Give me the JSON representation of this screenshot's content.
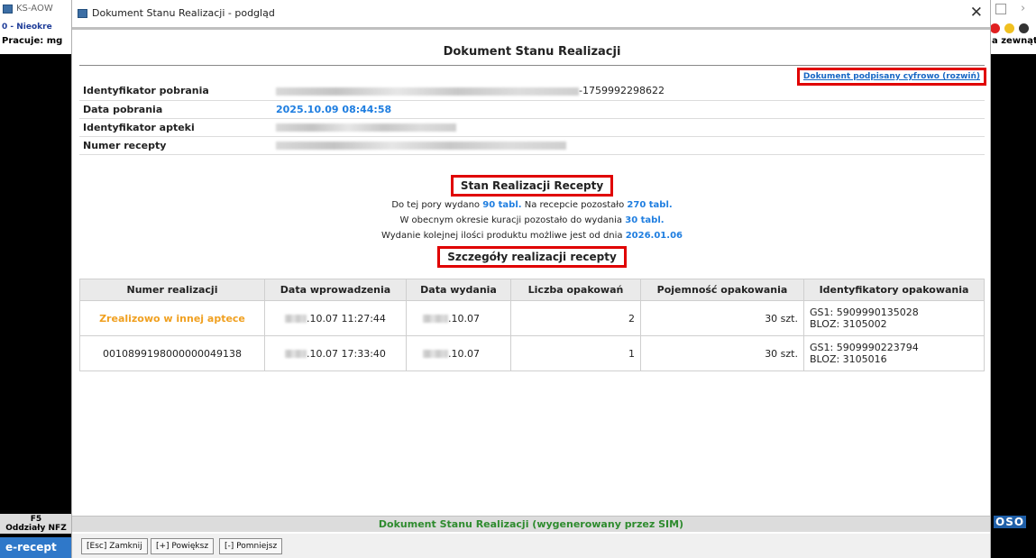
{
  "background": {
    "title": "KS-AOW",
    "status": "0 - Nieokre",
    "pracuje": "Pracuje: mg",
    "zewnat": "a zewnąt",
    "f5_key": "F5",
    "f5_label": "Oddziały NFZ",
    "erecept": "e-recept",
    "oso": "OSO"
  },
  "dialog": {
    "title": "Dokument Stanu Realizacji - podgląd",
    "header": "Dokument Stanu Realizacji",
    "signed_link": "Dokument podpisany cyfrowo (rozwiń)",
    "info": {
      "download_id_label": "Identyfikator pobrania",
      "download_id_suffix": "-1759992298622",
      "download_date_label": "Data pobrania",
      "download_date_value": "2025.10.09 08:44:58",
      "pharmacy_id_label": "Identyfikator apteki",
      "prescription_number_label": "Numer recepty"
    },
    "status": {
      "heading": "Stan Realizacji Recepty",
      "line1_a": "Do tej pory wydano ",
      "line1_v1": "90 tabl.",
      "line1_b": " Na recepcie pozostało ",
      "line1_v2": "270 tabl.",
      "line2_a": "W obecnym okresie kuracji pozostało do wydania ",
      "line2_v": "30 tabl.",
      "line3_a": "Wydanie kolejnej ilości produktu możliwe jest od dnia ",
      "line3_v": "2026.01.06"
    },
    "details": {
      "heading": "Szczegóły realizacji recepty",
      "columns": [
        "Numer realizacji",
        "Data wprowadzenia",
        "Data wydania",
        "Liczba opakowań",
        "Pojemność opakowania",
        "Identyfikatory opakowania"
      ],
      "rows": [
        {
          "number": "Zrealizowo w innej aptece",
          "date_in": ".10.07 11:27:44",
          "date_out": ".10.07",
          "qty": "2",
          "capacity": "30 szt.",
          "gs1": "GS1: 5909990135028",
          "bloz": "BLOZ: 3105002"
        },
        {
          "number": "0010899198000000049138",
          "date_in": ".10.07 17:33:40",
          "date_out": ".10.07",
          "qty": "1",
          "capacity": "30 szt.",
          "gs1": "GS1: 5909990223794",
          "bloz": "BLOZ: 3105016"
        }
      ]
    },
    "footer_status": "Dokument Stanu Realizacji (wygenerowany przez SIM)",
    "buttons": {
      "close": "[Esc] Zamknij",
      "zoom_in": "[+] Powiększ",
      "zoom_out": "[-] Pomniejsz"
    }
  },
  "colors": {
    "accent_blue": "#1f7ee0",
    "highlight_red": "#e00000",
    "orange": "#f0a020",
    "status_green": "#2e8b2e"
  }
}
